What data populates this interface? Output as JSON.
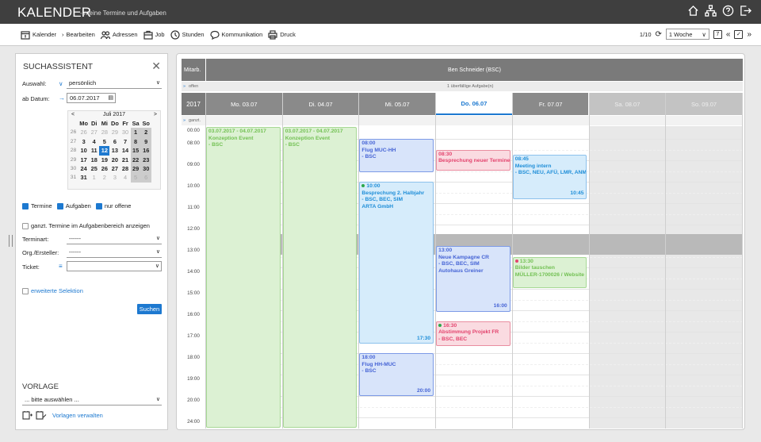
{
  "app": {
    "title": "KALENDER",
    "subtitle": "- meine Termine und Aufgaben"
  },
  "top_icons": [
    "home-icon",
    "sitemap-icon",
    "help-icon",
    "logout-icon"
  ],
  "toolbar": {
    "items": [
      {
        "label": "Kalender",
        "icon": "calendar-icon"
      },
      {
        "label": "Bearbeiten",
        "icon": "chevron-right-icon"
      },
      {
        "label": "Adressen",
        "icon": "contacts-icon"
      },
      {
        "label": "Job",
        "icon": "job-icon"
      },
      {
        "label": "Stunden",
        "icon": "clock-icon"
      },
      {
        "label": "Kommunikation",
        "icon": "speech-bubble-icon"
      },
      {
        "label": "Druck",
        "icon": "printer-icon"
      }
    ],
    "page": "1/10",
    "view": "1 Woche",
    "view_arrow": "∨",
    "nav_prev": "«",
    "nav_next": "»",
    "cal_icon": "7",
    "check_icon": "✓"
  },
  "sidebar": {
    "title": "SUCHASSISTENT",
    "close": "✕",
    "auswahl_label": "Auswahl:",
    "auswahl_value": "persönlich",
    "ab_datum_label": "ab Datum:",
    "ab_datum_value": "06.07.2017",
    "mini_cal": {
      "month": "Juli 2017",
      "prev": "<",
      "next": ">",
      "weekdays": [
        "Mo",
        "Di",
        "Mi",
        "Do",
        "Fr",
        "Sa",
        "So"
      ],
      "weeks": [
        {
          "kw": "26",
          "days": [
            "26",
            "27",
            "28",
            "29",
            "30",
            "1",
            "2"
          ]
        },
        {
          "kw": "27",
          "days": [
            "3",
            "4",
            "5",
            "6",
            "7",
            "8",
            "9"
          ]
        },
        {
          "kw": "28",
          "days": [
            "10",
            "11",
            "12",
            "13",
            "14",
            "15",
            "16"
          ]
        },
        {
          "kw": "29",
          "days": [
            "17",
            "18",
            "19",
            "20",
            "21",
            "22",
            "23"
          ]
        },
        {
          "kw": "30",
          "days": [
            "24",
            "25",
            "26",
            "27",
            "28",
            "29",
            "30"
          ]
        },
        {
          "kw": "31",
          "days": [
            "31",
            "1",
            "2",
            "3",
            "4",
            "5",
            "6"
          ]
        }
      ],
      "selected": "12"
    },
    "cb_termine": "Termine",
    "cb_aufgaben": "Aufgaben",
    "cb_offene": "nur offene",
    "cb_ganzt": "ganzt. Termine im Aufgabenbereich anzeigen",
    "terminart_label": "Terminart:",
    "terminart_value": "------",
    "org_label": "Org./Ersteller:",
    "org_value": "------",
    "ticket_label": "Ticket:",
    "ticket_icon": "list-icon",
    "ticket_value": "",
    "erweitert": "erweiterte Selektion",
    "suchen": "Suchen",
    "vorlage_title": "VORLAGE",
    "vorlage_value": "... bitte auswählen ...",
    "vorlage_link": "Vorlagen verwalten"
  },
  "calendar": {
    "col_label": "Mitarb.",
    "person": "Ben Schneider (BSC)",
    "offen_label": "offen",
    "offen_text": "1 überfällige Aufgabe(n)",
    "year": "2017",
    "ganzt_label": "ganzt.",
    "days": [
      {
        "label": "Mo. 03.07",
        "type": "wd"
      },
      {
        "label": "Di. 04.07",
        "type": "wd"
      },
      {
        "label": "Mi. 05.07",
        "type": "wd"
      },
      {
        "label": "Do. 06.07",
        "type": "today"
      },
      {
        "label": "Fr. 07.07",
        "type": "wd"
      },
      {
        "label": "Sa. 08.07",
        "type": "we"
      },
      {
        "label": "So. 09.07",
        "type": "we"
      }
    ],
    "times": [
      "00:00",
      "08:00",
      "09:00",
      "10:00",
      "11:00",
      "12:00",
      "13:00",
      "14:00",
      "15:00",
      "16:00",
      "17:00",
      "18:00",
      "19:00",
      "20:00",
      "24:00"
    ],
    "events": [
      {
        "day": 0,
        "start": 0,
        "end": 24,
        "color": "green",
        "lines": [
          "03.07.2017 - 04.07.2017",
          "Konzeption Event",
          "- BSC"
        ]
      },
      {
        "day": 1,
        "start": 0,
        "end": 24,
        "color": "green",
        "lines": [
          "03.07.2017 - 04.07.2017",
          "Konzeption Event",
          "- BSC"
        ]
      },
      {
        "day": 2,
        "start": 8,
        "end": 9.6,
        "color": "blue",
        "lines": [
          "08:00",
          "Flug MUC-HH",
          "- BSC"
        ]
      },
      {
        "day": 2,
        "start": 10,
        "end": 17.6,
        "color": "lblue",
        "dot": "#2ca84b",
        "lines": [
          "10:00",
          "Besprechung 2. Halbjahr",
          "- BSC, BEC, SIM",
          "ARTA GmbH"
        ],
        "end_label": "17:30"
      },
      {
        "day": 2,
        "start": 18,
        "end": 20.2,
        "color": "blue",
        "lines": [
          "18:00",
          "Flug HH-MUC",
          "- BSC"
        ],
        "end_label": "20:00"
      },
      {
        "day": 3,
        "start": 8.5,
        "end": 9.5,
        "color": "pink",
        "lines": [
          "08:30",
          "Besprechung neuer Termine"
        ]
      },
      {
        "day": 3,
        "start": 13,
        "end": 16.1,
        "color": "blue",
        "lines": [
          "13:00",
          "Neue Kampagne CR",
          "- BSC, BEC, SIM",
          "Autohaus Greiner"
        ],
        "end_label": "16:00"
      },
      {
        "day": 3,
        "start": 16.5,
        "end": 17.7,
        "color": "pink",
        "dot": "#2ca84b",
        "lines": [
          "16:30",
          "Abstimmung Projekt FR",
          "- BSC, BEC"
        ]
      },
      {
        "day": 4,
        "start": 8.75,
        "end": 10.85,
        "color": "lblue",
        "lines": [
          "08:45",
          "Meeting intern",
          "- BSC, NEU, AFÜ, LMR, ANM"
        ],
        "end_label": "10:45"
      },
      {
        "day": 4,
        "start": 13.5,
        "end": 15,
        "color": "green",
        "dot": "#e3446e",
        "lines": [
          "13:30",
          "Bilder tauschen",
          "MÜLLER-1700026 / Website"
        ]
      }
    ]
  }
}
